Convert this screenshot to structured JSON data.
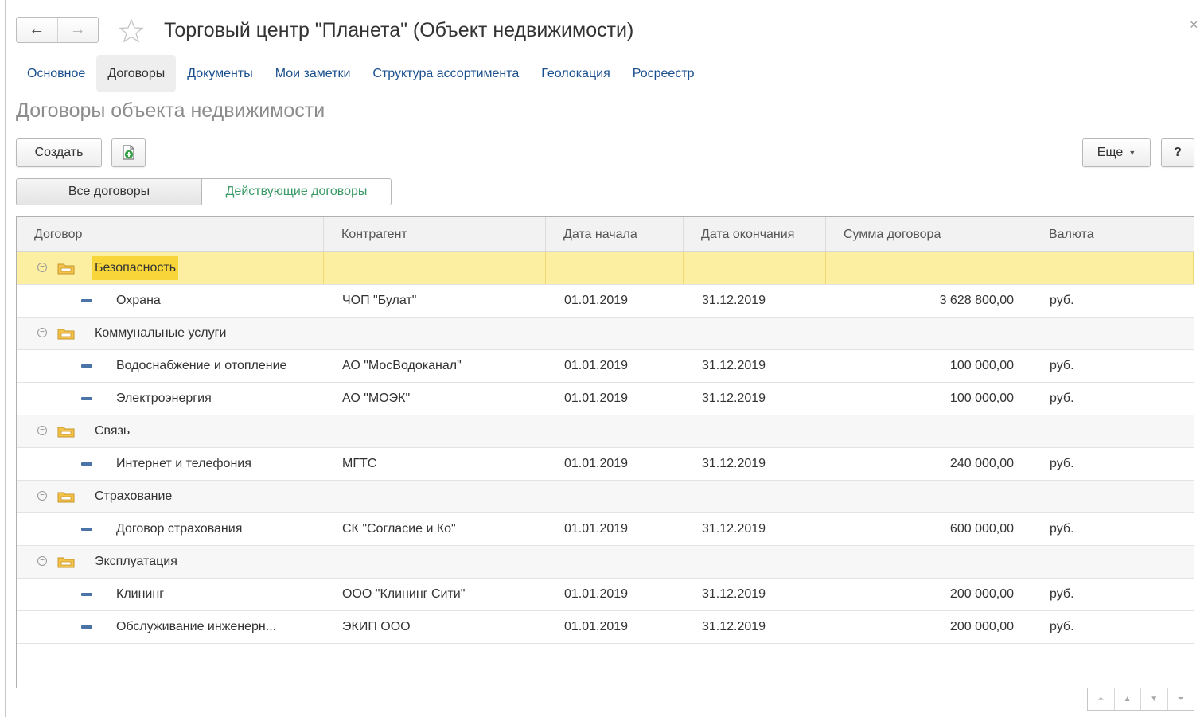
{
  "window": {
    "title": "Торговый центр \"Планета\" (Объект недвижимости)",
    "close": "×",
    "back": "←",
    "forward": "→"
  },
  "tabs": [
    {
      "label": "Основное"
    },
    {
      "label": "Договоры"
    },
    {
      "label": "Документы"
    },
    {
      "label": "Мои заметки"
    },
    {
      "label": "Структура ассортимента"
    },
    {
      "label": "Геолокация"
    },
    {
      "label": "Росреестр"
    }
  ],
  "section": {
    "title": "Договоры объекта недвижимости"
  },
  "toolbar": {
    "create": "Создать",
    "more": "Еще",
    "help": "?"
  },
  "filter": {
    "all": "Все договоры",
    "active": "Действующие договоры"
  },
  "table": {
    "columns": [
      "Договор",
      "Контрагент",
      "Дата начала",
      "Дата окончания",
      "Сумма договора",
      "Валюта"
    ],
    "groups": [
      {
        "name": "Безопасность",
        "items": [
          {
            "name": "Охрана",
            "party": "ЧОП \"Булат\"",
            "start": "01.01.2019",
            "end": "31.12.2019",
            "sum": "3 628 800,00",
            "cur": "руб."
          }
        ]
      },
      {
        "name": "Коммунальные услуги",
        "items": [
          {
            "name": "Водоснабжение и отопление",
            "party": "АО \"МосВодоканал\"",
            "start": "01.01.2019",
            "end": "31.12.2019",
            "sum": "100 000,00",
            "cur": "руб."
          },
          {
            "name": "Электроэнергия",
            "party": "АО \"МОЭК\"",
            "start": "01.01.2019",
            "end": "31.12.2019",
            "sum": "100 000,00",
            "cur": "руб."
          }
        ]
      },
      {
        "name": "Связь",
        "items": [
          {
            "name": "Интернет и телефония",
            "party": "МГТС",
            "start": "01.01.2019",
            "end": "31.12.2019",
            "sum": "240 000,00",
            "cur": "руб."
          }
        ]
      },
      {
        "name": "Страхование",
        "items": [
          {
            "name": "Договор страхования",
            "party": "СК \"Согласие и Ко\"",
            "start": "01.01.2019",
            "end": "31.12.2019",
            "sum": "600 000,00",
            "cur": "руб."
          }
        ]
      },
      {
        "name": "Эксплуатация",
        "items": [
          {
            "name": "Клининг",
            "party": "ООО \"Клининг Сити\"",
            "start": "01.01.2019",
            "end": "31.12.2019",
            "sum": "200 000,00",
            "cur": "руб."
          },
          {
            "name": "Обслуживание инженерн...",
            "party": "ЭКИП ООО",
            "start": "01.01.2019",
            "end": "31.12.2019",
            "sum": "200 000,00",
            "cur": "руб."
          }
        ]
      }
    ]
  },
  "icons": {
    "star": "star-icon",
    "add_file": "add-file-icon",
    "folder": "folder-icon",
    "collapse": "collapse-icon",
    "item": "item-dash-icon"
  },
  "colors": {
    "link": "#1a4f8d",
    "active_filter": "#3b9a66",
    "selected_row": "#fcefa1",
    "selected_cell": "#f8d63a",
    "item_marker": "#4a73a8"
  }
}
